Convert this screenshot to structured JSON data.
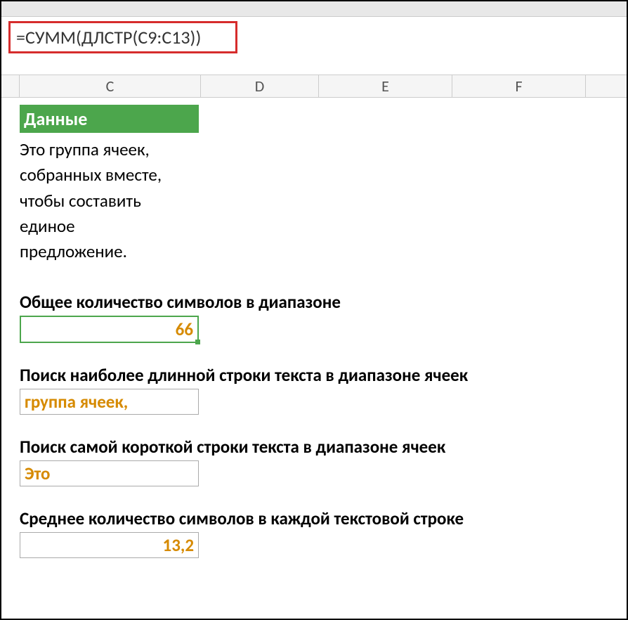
{
  "formula_bar": "=СУММ(ДЛСТР(C9:C13))",
  "columns": {
    "c": "C",
    "d": "D",
    "e": "E",
    "f": "F"
  },
  "header_cell": "Данные",
  "data_lines": {
    "line1": "Это группа ячеек,",
    "line2": "собранных вместе,",
    "line3": "чтобы составить",
    "line4": "единое",
    "line5": "предложение."
  },
  "sections": {
    "total_chars": {
      "label": "Общее количество символов в диапазоне",
      "value": "66"
    },
    "longest": {
      "label": "Поиск наиболее длинной строки текста в диапазоне ячеек",
      "value": "группа ячеек,"
    },
    "shortest": {
      "label": "Поиск самой короткой строки текста в диапазоне ячеек",
      "value": "Это"
    },
    "average": {
      "label": "Среднее количество символов в каждой текстовой строке",
      "value": "13,2"
    }
  }
}
